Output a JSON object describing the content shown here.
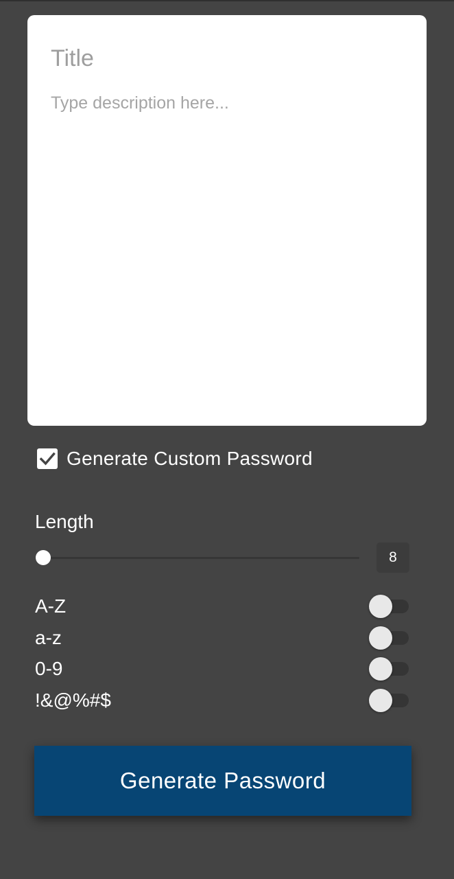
{
  "note": {
    "title_placeholder": "Title",
    "description_placeholder": "Type description here...",
    "title_value": "",
    "description_value": ""
  },
  "custom_password": {
    "label": "Generate Custom Password",
    "checked": true
  },
  "length": {
    "label": "Length",
    "value": "8"
  },
  "options": [
    {
      "label": "A-Z",
      "enabled": false
    },
    {
      "label": "a-z",
      "enabled": false
    },
    {
      "label": "0-9",
      "enabled": false
    },
    {
      "label": "!&@%#$",
      "enabled": false
    }
  ],
  "actions": {
    "generate_label": "Generate Password"
  },
  "colors": {
    "background": "#444444",
    "card": "#ffffff",
    "button": "#074574",
    "text": "#ffffff"
  },
  "icons": {
    "checkbox": "check-icon"
  }
}
